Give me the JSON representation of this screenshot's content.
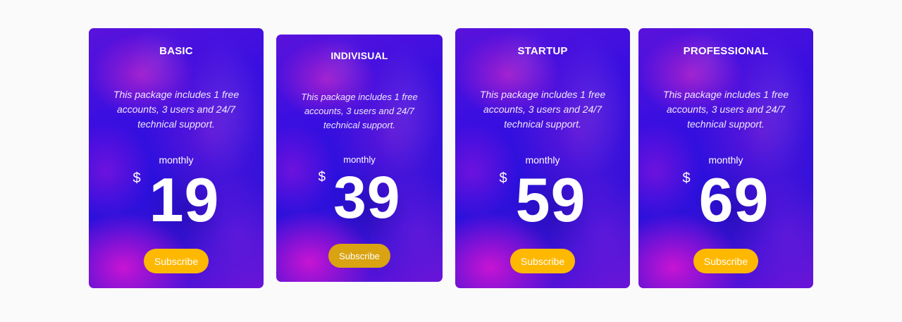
{
  "colors": {
    "page_background": "#fafafa",
    "card_primary": "#2a10dd",
    "card_accent": "#e114d2",
    "subscribe_button": "#ffb800",
    "subscribe_button_dimmed": "#d9a312",
    "text": "#ffffff"
  },
  "plans": [
    {
      "name": "BASIC",
      "description": "This package includes 1 free accounts, 3 users and 24/7 technical support.",
      "period": "monthly",
      "currency": "$",
      "price": "19",
      "button_label": "Subscribe"
    },
    {
      "name": "INDIVISUAL",
      "description": "This package includes 1 free accounts, 3 users and 24/7 technical support.",
      "period": "monthly",
      "currency": "$",
      "price": "39",
      "button_label": "Subscribe"
    },
    {
      "name": "STARTUP",
      "description": "This package includes 1 free accounts, 3 users and 24/7 technical support.",
      "period": "monthly",
      "currency": "$",
      "price": "59",
      "button_label": "Subscribe"
    },
    {
      "name": "PROFESSIONAL",
      "description": "This package includes 1 free accounts, 3 users and 24/7 technical support.",
      "period": "monthly",
      "currency": "$",
      "price": "69",
      "button_label": "Subscribe"
    }
  ]
}
